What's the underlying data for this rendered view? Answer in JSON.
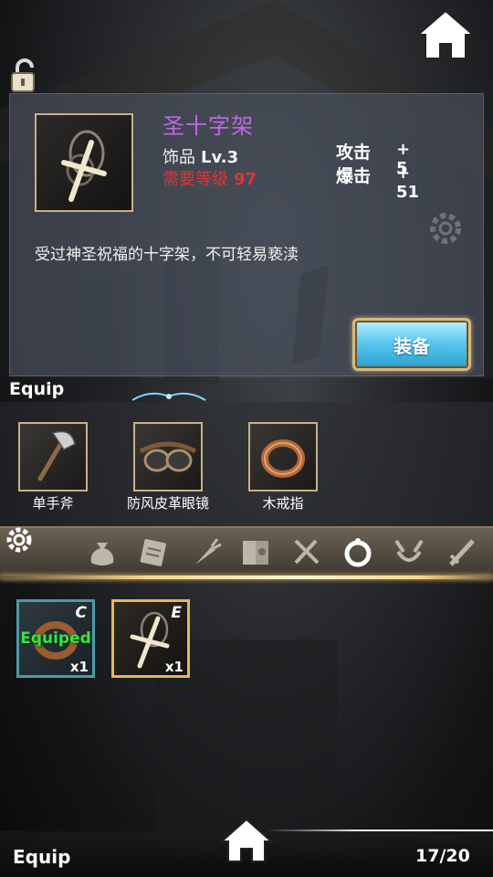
{
  "detail": {
    "item_name": "圣十字架",
    "type_label": "饰品",
    "level": "Lv.3",
    "req_label": "需要等级",
    "req_value": "97",
    "stats": [
      {
        "label": "攻击",
        "value": "+ 5"
      },
      {
        "label": "爆击",
        "value": "+ 51"
      }
    ],
    "description": "受过神圣祝福的十字架，不可轻易亵渎",
    "equip_button": "装备"
  },
  "equip_section": {
    "label": "Equip",
    "slots": [
      {
        "label": "单手斧",
        "icon": "axe-icon"
      },
      {
        "label": "防风皮革眼镜",
        "icon": "goggles-icon"
      },
      {
        "label": "木戒指",
        "icon": "ring-icon"
      }
    ]
  },
  "categories": [
    {
      "icon": "bag-icon"
    },
    {
      "icon": "scroll-icon"
    },
    {
      "icon": "carrot-icon"
    },
    {
      "icon": "book-icon"
    },
    {
      "icon": "fork-knife-icon"
    },
    {
      "icon": "ring-icon"
    },
    {
      "icon": "cat-ears-icon"
    },
    {
      "icon": "sword-icon"
    }
  ],
  "inventory": [
    {
      "grade": "C",
      "status": "Equiped",
      "qty": "x1",
      "icon": "ring-icon"
    },
    {
      "grade": "E",
      "qty": "x1",
      "icon": "cross-icon"
    }
  ],
  "footer": {
    "label": "Equip",
    "count": "17/20"
  },
  "colors": {
    "item_name": "#c066e6",
    "requirement": "#e0343a",
    "equiped": "#39e04a",
    "gold_frame": "#c8b08a"
  }
}
